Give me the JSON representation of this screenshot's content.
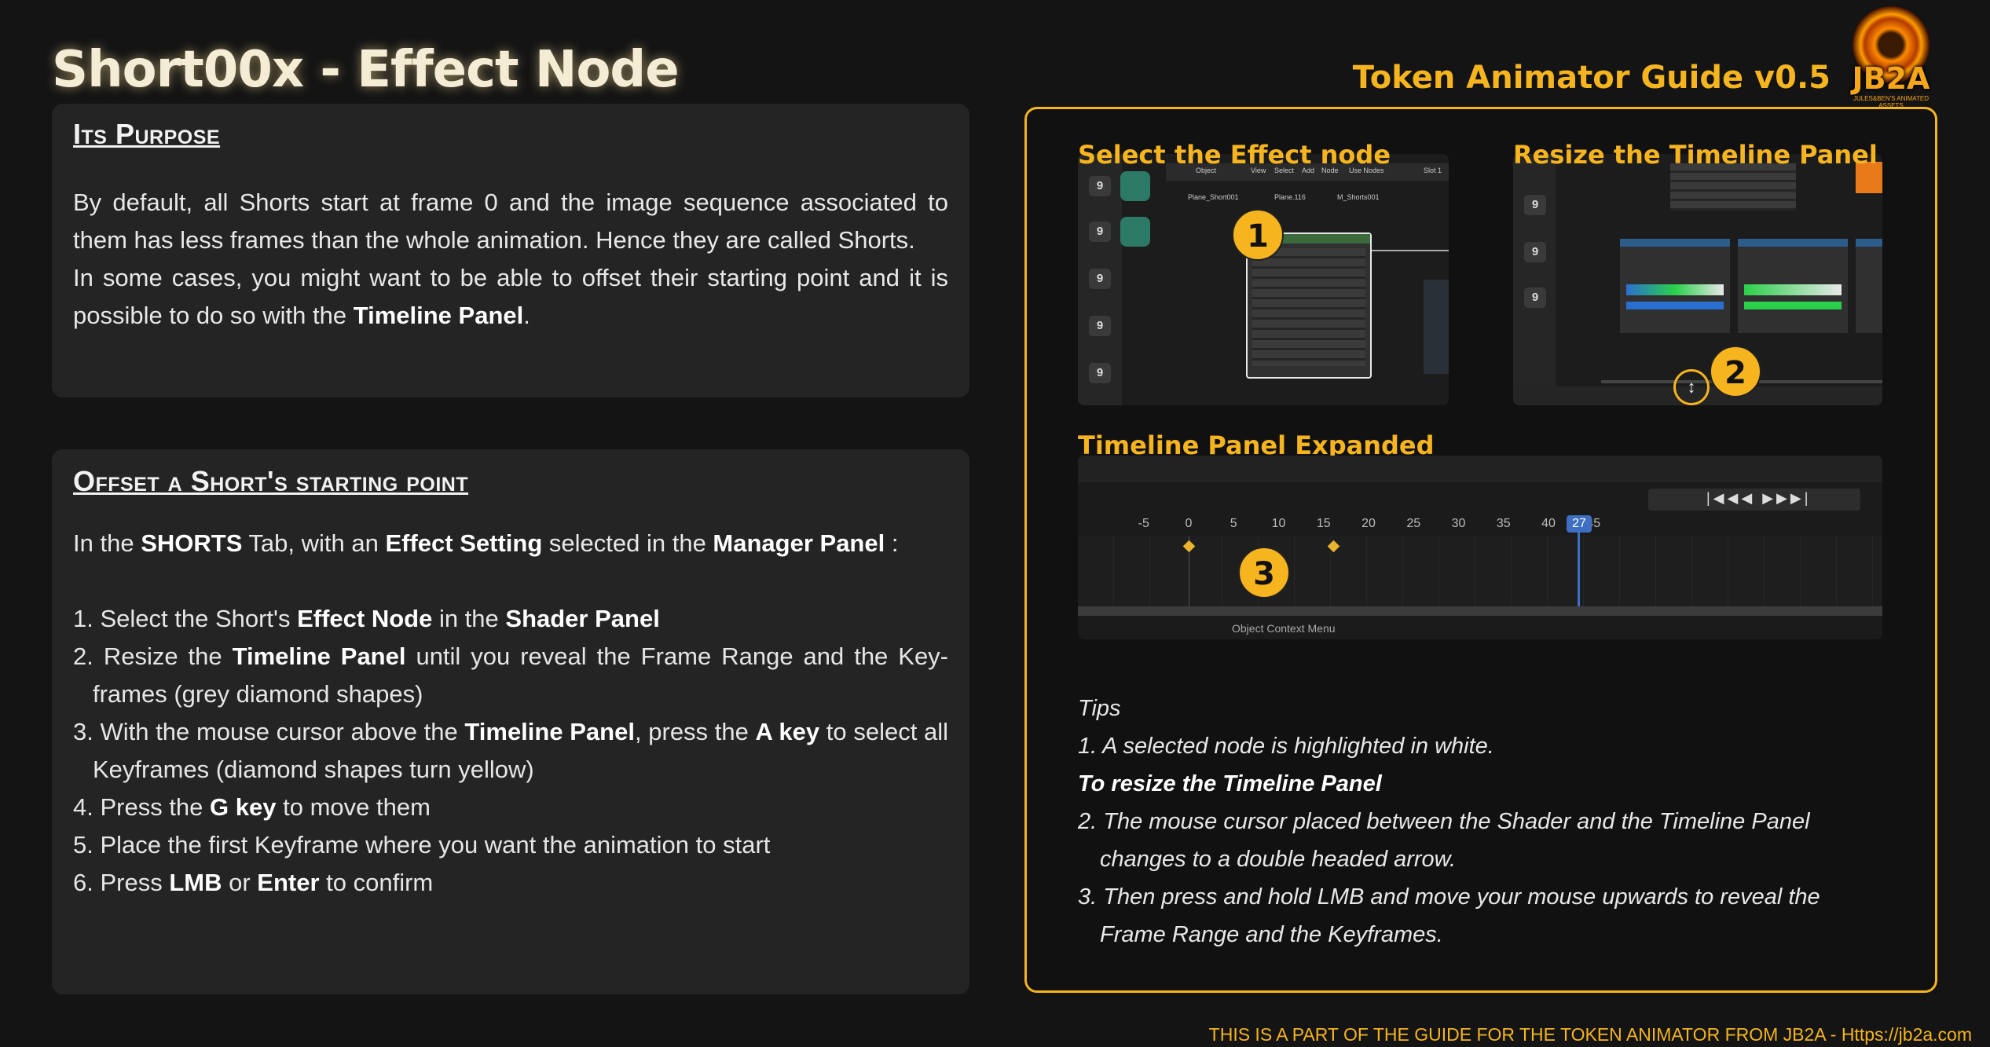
{
  "page_title": "Short00x - Effect Node",
  "guide_title": "Token Animator Guide v0.5",
  "logo": {
    "text": "JB2A",
    "subtext": "JULES&BEN'S ANIMATED ASSETS"
  },
  "purpose": {
    "heading": "Its Purpose",
    "p1": "By default, all Shorts start at frame 0 and the image sequence associated to them has less frames than the whole animation. Hence they are called Shorts.",
    "p2_pre": "In some cases, you might want to be able to offset their starting point and it is possible to do so with the ",
    "p2_bold": "Timeline Panel",
    "p2_post": "."
  },
  "offset": {
    "heading": "Offset a Short's starting point",
    "intro": [
      {
        "t": "In the ",
        "b": false
      },
      {
        "t": "SHORTS",
        "b": true
      },
      {
        "t": " Tab, with an ",
        "b": false
      },
      {
        "t": "Effect Setting",
        "b": true
      },
      {
        "t": " selected in the ",
        "b": false
      },
      {
        "t": "Manager Panel",
        "b": true
      },
      {
        "t": " :",
        "b": false
      }
    ],
    "steps": [
      [
        {
          "t": "1.  Select the Short's ",
          "b": false
        },
        {
          "t": "Effect Node",
          "b": true
        },
        {
          "t": " in the ",
          "b": false
        },
        {
          "t": "Shader Panel",
          "b": true
        }
      ],
      [
        {
          "t": "2.  Resize the ",
          "b": false
        },
        {
          "t": "Timeline Panel",
          "b": true
        },
        {
          "t": " until you reveal the Frame Range and the Key-frames (grey diamond shapes)",
          "b": false
        }
      ],
      [
        {
          "t": "3.  With the mouse cursor above the ",
          "b": false
        },
        {
          "t": "Timeline Panel",
          "b": true
        },
        {
          "t": ", press the ",
          "b": false
        },
        {
          "t": "A key",
          "b": true
        },
        {
          "t": " to select all Keyframes (diamond shapes turn yellow)",
          "b": false
        }
      ],
      [
        {
          "t": "4.  Press the ",
          "b": false
        },
        {
          "t": "G key",
          "b": true
        },
        {
          "t": " to move them",
          "b": false
        }
      ],
      [
        {
          "t": "5.  Place the first Keyframe where you want the animation to start",
          "b": false
        }
      ],
      [
        {
          "t": "6.  Press ",
          "b": false
        },
        {
          "t": "LMB",
          "b": true
        },
        {
          "t": " or ",
          "b": false
        },
        {
          "t": "Enter",
          "b": true
        },
        {
          "t": " to confirm",
          "b": false
        }
      ]
    ]
  },
  "screens": {
    "select_label": "Select the Effect node",
    "resize_label": "Resize the Timeline Panel",
    "expanded_label": "Timeline Panel Expanded",
    "badges": [
      "1",
      "2",
      "3"
    ],
    "shader_menu": [
      "Object",
      "View",
      "Select",
      "Add",
      "Node",
      "Use Nodes",
      "Slot 1"
    ],
    "shader_breadcrumb": [
      "Plane_Short001",
      "Plane.116",
      "M_Shorts001"
    ],
    "timeline_numbers": [
      "-5",
      "0",
      "5",
      "10",
      "15",
      "20",
      "25",
      "27",
      "30",
      "35",
      "40",
      "45"
    ],
    "timeline_current": "27",
    "timeline_status": "Object Context Menu"
  },
  "tips": {
    "heading": "Tips",
    "t1": "1. A selected node is highlighted in white.",
    "t_bold": "To resize the Timeline Panel",
    "t2": "2. The mouse cursor placed between the Shader and the Timeline Panel changes to a double headed arrow.",
    "t3": "3. Then press and hold LMB and move your mouse upwards to reveal the Frame Range and the Keyframes."
  },
  "footer": "THIS IS A PART OF THE GUIDE FOR THE TOKEN ANIMATOR FROM JB2A - Https://jb2a.com",
  "colors": {
    "accent": "#f6b41e",
    "card": "#242424",
    "background": "#141414"
  }
}
